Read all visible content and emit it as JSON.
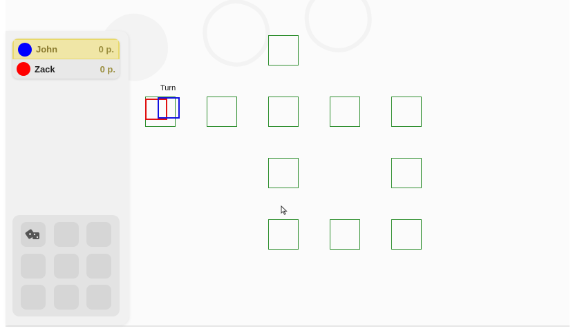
{
  "players": [
    {
      "name": "John",
      "score": "0 p.",
      "color": "#0000ff",
      "active": true
    },
    {
      "name": "Zack",
      "score": "0 p.",
      "color": "#ff0000",
      "active": false
    }
  ],
  "board": {
    "turn_label": "Turn",
    "tile_color": "#2f8f2f"
  },
  "controls": {
    "dice_icon": "dice-icon"
  }
}
